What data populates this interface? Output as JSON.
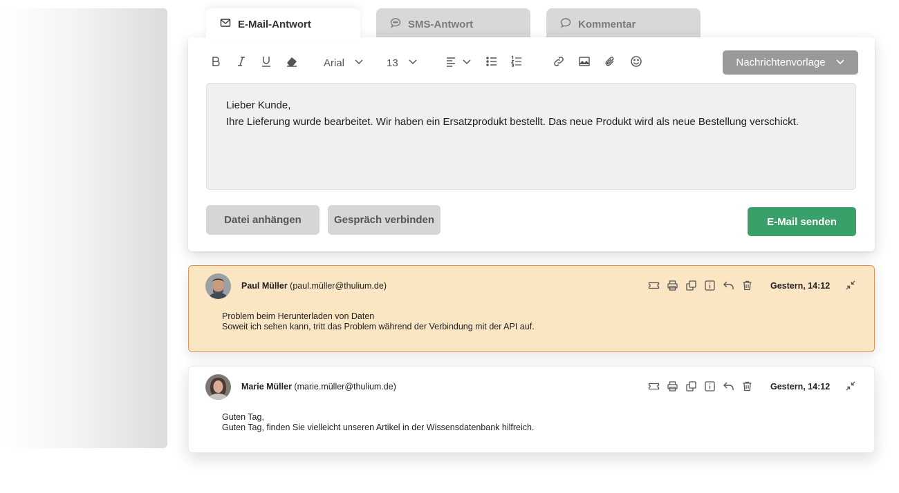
{
  "tabs": [
    {
      "label": "E-Mail-Antwort",
      "icon": "mail-icon",
      "active": true
    },
    {
      "label": "SMS-Antwort",
      "icon": "sms-bubble-icon",
      "active": false
    },
    {
      "label": "Kommentar",
      "icon": "comment-bubble-icon",
      "active": false
    }
  ],
  "toolbar": {
    "font_family": "Arial",
    "font_size": "13",
    "template_label": "Nachrichtenvorlage"
  },
  "editor": {
    "line1": "Lieber Kunde,",
    "line2": "Ihre Lieferung wurde bearbeitet. Wir haben ein Ersatzprodukt bestellt. Das neue Produkt wird als neue Bestellung verschickt."
  },
  "buttons": {
    "attach": "Datei anhängen",
    "connect": "Gespräch verbinden",
    "send": "E-Mail senden"
  },
  "messages": [
    {
      "name": "Paul Müller",
      "email": "(paul.müller@thulium.de)",
      "time": "Gestern, 14:12",
      "line1": "Problem beim Herunterladen von Daten",
      "line2": "Soweit ich sehen kann, tritt das Problem während der Verbindung mit der API auf.",
      "highlight": true
    },
    {
      "name": "Marie Müller",
      "email": "(marie.müller@thulium.de)",
      "time": "Gestern, 14:12",
      "line1": "Guten Tag,",
      "line2": "Guten Tag, finden Sie vielleicht unseren Artikel in der Wissensdatenbank hilfreich.",
      "highlight": false
    }
  ],
  "colors": {
    "accent_green": "#3aa06a",
    "highlight_bg": "#fbe6c3",
    "highlight_border": "#e0965a",
    "template_button": "#9a9a9a"
  }
}
